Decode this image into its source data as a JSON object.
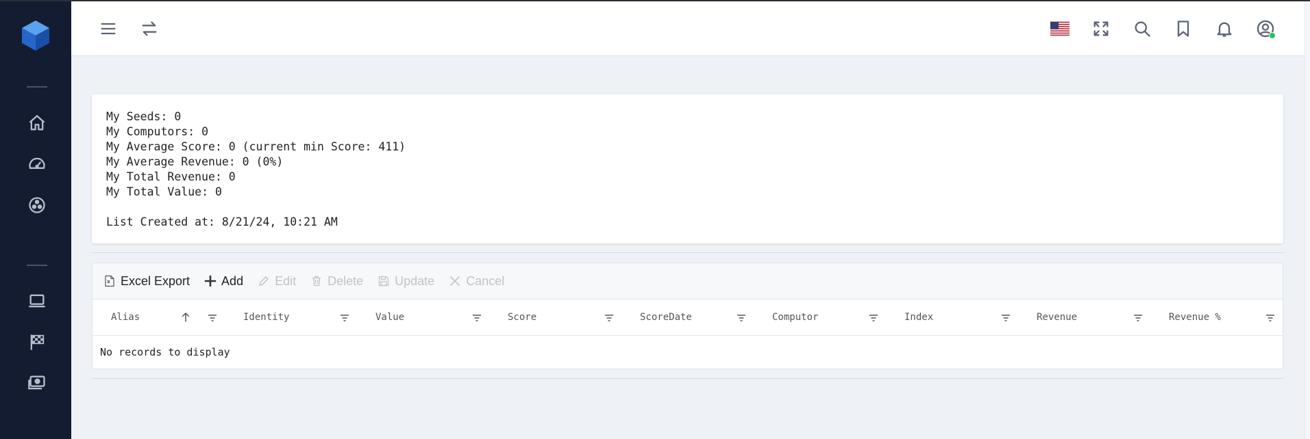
{
  "topbar": {
    "icons": [
      "menu-icon",
      "swap-icon",
      "us-flag-icon",
      "fullscreen-icon",
      "search-icon",
      "bookmark-icon",
      "bell-icon",
      "user-icon"
    ],
    "user_status_color": "#22c55e"
  },
  "sidebar": {
    "background": "#141c32",
    "items": [
      "home-icon",
      "dashboard-icon",
      "network-icon",
      "laptop-icon",
      "race-flag-icon",
      "money-icon"
    ]
  },
  "summary": {
    "seeds": "My Seeds: 0",
    "computors": "My Computors: 0",
    "avg_score": "My Average Score: 0 (current min Score: 411)",
    "avg_revenue": "My Average Revenue: 0 (0%)",
    "total_revenue": "My Total Revenue: 0",
    "total_value": "My Total Value: 0",
    "created_at": "List Created at: 8/21/24, 10:21 AM"
  },
  "toolbar": {
    "excel_export": "Excel Export",
    "add": "Add",
    "edit": "Edit",
    "delete": "Delete",
    "update": "Update",
    "cancel": "Cancel"
  },
  "grid": {
    "columns": [
      "Alias",
      "Identity",
      "Value",
      "Score",
      "ScoreDate",
      "Computor",
      "Index",
      "Revenue",
      "Revenue %"
    ],
    "sorted_column": "Alias",
    "sort_direction": "ascending",
    "empty_message": "No records to display",
    "rows": []
  }
}
